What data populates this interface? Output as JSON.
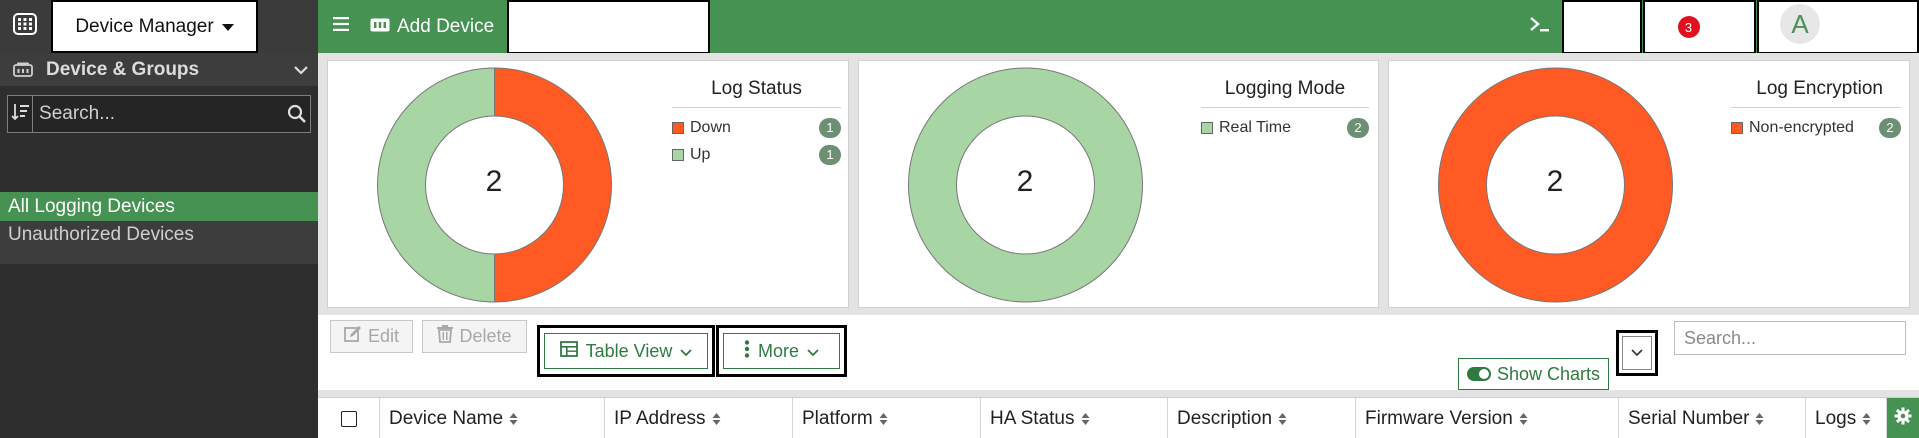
{
  "header": {
    "product_title": "Device Manager",
    "add_device_label": "Add Device",
    "cli_icon": "terminal-icon",
    "notification_count": "3",
    "avatar_initial": "A"
  },
  "sidebar": {
    "section_title": "Device & Groups",
    "search_placeholder": "Search...",
    "items": [
      {
        "label": "All Logging Devices",
        "active": true
      },
      {
        "label": "Unauthorized Devices",
        "active": false
      }
    ]
  },
  "cards": [
    {
      "title": "Log Status",
      "total": "2",
      "legend": [
        {
          "label": "Down",
          "count": "1",
          "color": "#ff5a24"
        },
        {
          "label": "Up",
          "count": "1",
          "color": "#a8d5a4"
        }
      ]
    },
    {
      "title": "Logging Mode",
      "total": "2",
      "legend": [
        {
          "label": "Real Time",
          "count": "2",
          "color": "#a8d5a4"
        }
      ]
    },
    {
      "title": "Log Encryption",
      "total": "2",
      "legend": [
        {
          "label": "Non-encrypted",
          "count": "2",
          "color": "#ff5a24"
        }
      ]
    }
  ],
  "toolbar": {
    "edit_label": "Edit",
    "delete_label": "Delete",
    "table_view_label": "Table View",
    "more_label": "More",
    "show_charts_label": "Show Charts",
    "search_placeholder": "Search..."
  },
  "table": {
    "columns": [
      "Device Name",
      "IP Address",
      "Platform",
      "HA Status",
      "Description",
      "Firmware Version",
      "Serial Number",
      "Logs"
    ]
  },
  "colors": {
    "accent_green": "#459253",
    "down_orange": "#ff5a24",
    "up_green": "#a8d5a4"
  }
}
